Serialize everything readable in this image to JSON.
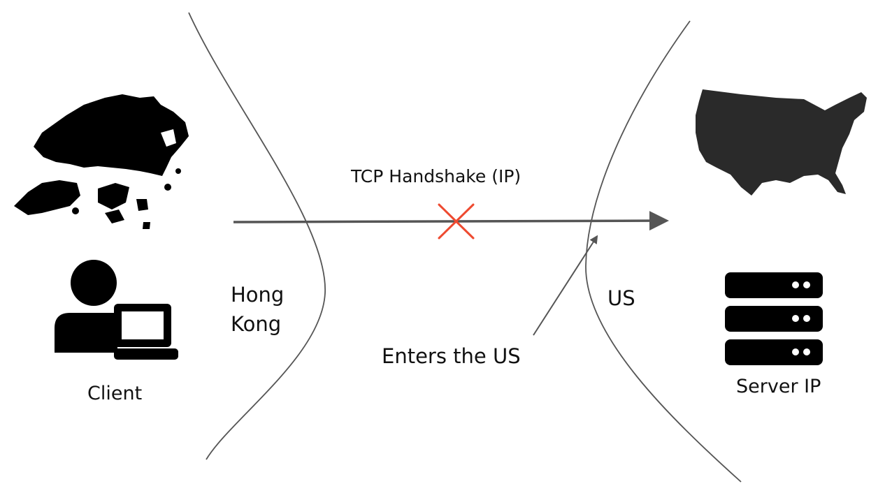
{
  "labels": {
    "handshake": "TCP Handshake (IP)",
    "hong": "Hong",
    "kong": "Kong",
    "us": "US",
    "enters": "Enters the US",
    "client": "Client",
    "server": "Server IP"
  },
  "colors": {
    "line": "#555555",
    "cross": "#ee4a30",
    "silhouette": "#000000",
    "us_map": "#2a2a2a"
  },
  "icons": [
    "hong-kong-map-icon",
    "us-map-icon",
    "client-user-laptop-icon",
    "server-stack-icon",
    "blocked-cross-icon"
  ]
}
